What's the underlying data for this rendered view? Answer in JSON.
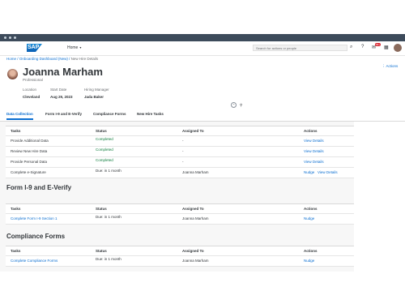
{
  "shell": {
    "logo": "SAP",
    "home_label": "Home",
    "search_placeholder": "Search for actions or people",
    "notif_badge": "99+"
  },
  "breadcrumb": {
    "home": "Home",
    "dashboard": "Onboarding Dashboard (New)",
    "current": "New Hire Details",
    "sep": "/"
  },
  "header": {
    "name": "Joanna Marham",
    "role": "Professional",
    "actions_label": "Actions",
    "fields": [
      {
        "label": "Location",
        "value": "Cleveland"
      },
      {
        "label": "Start Date",
        "value": "Aug 29, 2023"
      },
      {
        "label": "Hiring Manager",
        "value": "Jada Baker"
      }
    ]
  },
  "tabs": [
    {
      "label": "Data Collection",
      "active": true
    },
    {
      "label": "Form I-9 and E-Verify",
      "active": false
    },
    {
      "label": "Compliance Forms",
      "active": false
    },
    {
      "label": "New Hire Tasks",
      "active": false
    }
  ],
  "columns": {
    "tasks": "Tasks",
    "status": "Status",
    "assigned": "Assigned To",
    "actions": "Actions"
  },
  "sections": [
    {
      "title": "",
      "rows": [
        {
          "task": "Provide Additional Data",
          "status": "Completed",
          "assigned": "-",
          "action1": "View Details",
          "action2": ""
        },
        {
          "task": "Review New Hire Data",
          "status": "Completed",
          "assigned": "-",
          "action1": "View Details",
          "action2": ""
        },
        {
          "task": "Provide Personal Data",
          "status": "Completed",
          "assigned": "-",
          "action1": "View Details",
          "action2": ""
        },
        {
          "task": "Complete e-Signature",
          "status": "Due: in 1 month",
          "assigned": "Joanna Marham",
          "action1": "Nudge",
          "action2": "View Details"
        }
      ]
    },
    {
      "title": "Form I-9 and E-Verify",
      "rows": [
        {
          "task": "Complete Form I-9 Section 1",
          "status": "Due: in 1 month",
          "assigned": "Joanna Marham",
          "action1": "Nudge",
          "action2": ""
        }
      ]
    },
    {
      "title": "Compliance Forms",
      "rows": [
        {
          "task": "Complete Compliance Forms",
          "status": "Due: in 1 month",
          "assigned": "Joanna Marham",
          "action1": "Nudge",
          "action2": ""
        }
      ]
    }
  ]
}
